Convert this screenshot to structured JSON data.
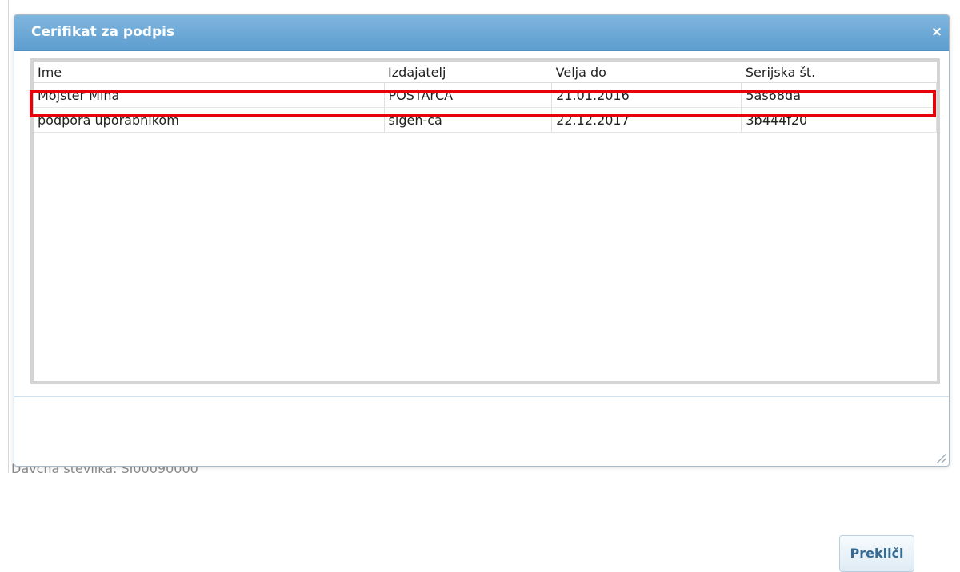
{
  "background": {
    "partial_text": "Davčna številka: SI00090000"
  },
  "dialog": {
    "title": "Cerifikat za podpis",
    "close_symbol": "×",
    "columns": [
      "Ime",
      "Izdajatelj",
      "Velja do",
      "Serijska št."
    ],
    "rows": [
      {
        "name": "Mojster Miha",
        "issuer": "POSTArCA",
        "valid_to": "21.01.2016",
        "serial": "5as68da"
      },
      {
        "name": "podpora uporabnikom",
        "issuer": "sigen-ca",
        "valid_to": "22.12.2017",
        "serial": "3b444f20"
      }
    ],
    "cancel_label": "Prekliči",
    "highlight_color": "#e8000b"
  }
}
